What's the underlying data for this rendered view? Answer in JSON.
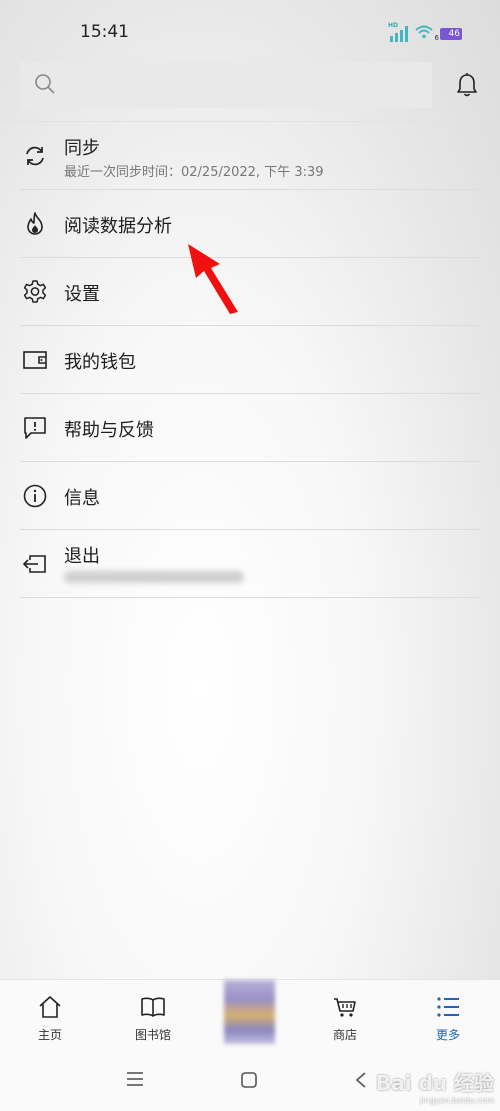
{
  "status_bar": {
    "time": "15:41",
    "network_badge": "HD",
    "wifi_badge": "6",
    "battery_level": "46"
  },
  "header": {
    "search_placeholder": ""
  },
  "menu": {
    "items": [
      {
        "label": "同步",
        "sub": "最近一次同步时间：02/25/2022, 下午 3:39",
        "icon": "sync-icon"
      },
      {
        "label": "阅读数据分析",
        "icon": "flame-icon"
      },
      {
        "label": "设置",
        "icon": "gear-icon"
      },
      {
        "label": "我的钱包",
        "icon": "wallet-icon"
      },
      {
        "label": "帮助与反馈",
        "icon": "feedback-icon"
      },
      {
        "label": "信息",
        "icon": "info-icon"
      },
      {
        "label": "退出",
        "icon": "logout-icon"
      }
    ]
  },
  "bottom_nav": {
    "items": [
      {
        "label": "主页",
        "icon": "home-icon"
      },
      {
        "label": "图书馆",
        "icon": "book-icon"
      },
      {
        "label": "",
        "icon": "current-book-thumbnail"
      },
      {
        "label": "商店",
        "icon": "cart-icon"
      },
      {
        "label": "更多",
        "icon": "list-icon",
        "active": true
      }
    ]
  },
  "colors": {
    "accent": "#1f64b5",
    "annotation_arrow": "#f01010",
    "status_teal": "#45b6c0",
    "battery": "#7a57d1"
  },
  "watermark": {
    "text": "Bai du 经验",
    "sub": "jingyan.baidu.com"
  }
}
